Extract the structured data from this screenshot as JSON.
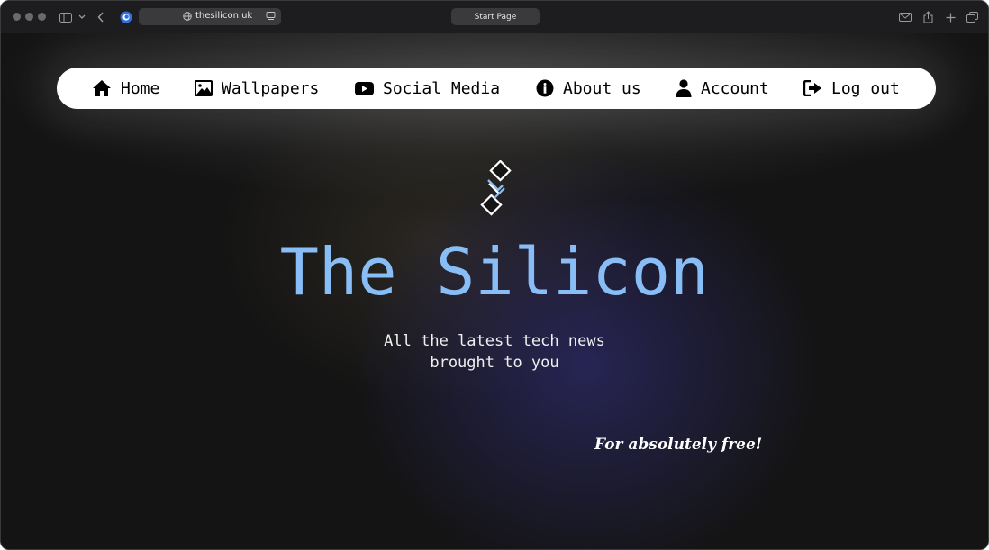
{
  "browser": {
    "url": "thesilicon.uk",
    "tab_title": "Start Page"
  },
  "nav": {
    "items": [
      {
        "label": "Home",
        "icon": "home-icon"
      },
      {
        "label": "Wallpapers",
        "icon": "image-icon"
      },
      {
        "label": "Social Media",
        "icon": "youtube-icon"
      },
      {
        "label": "About us",
        "icon": "info-icon"
      },
      {
        "label": "Account",
        "icon": "user-icon"
      },
      {
        "label": "Log out",
        "icon": "logout-icon"
      }
    ]
  },
  "hero": {
    "title": "The Silicon",
    "subtitle_line1": "All the latest tech news",
    "subtitle_line2": "brought to you",
    "tagline": "For absolutely free!"
  },
  "colors": {
    "accent": "#89bdf5",
    "page_background": "#141414",
    "navbar_background": "#ffffff"
  }
}
